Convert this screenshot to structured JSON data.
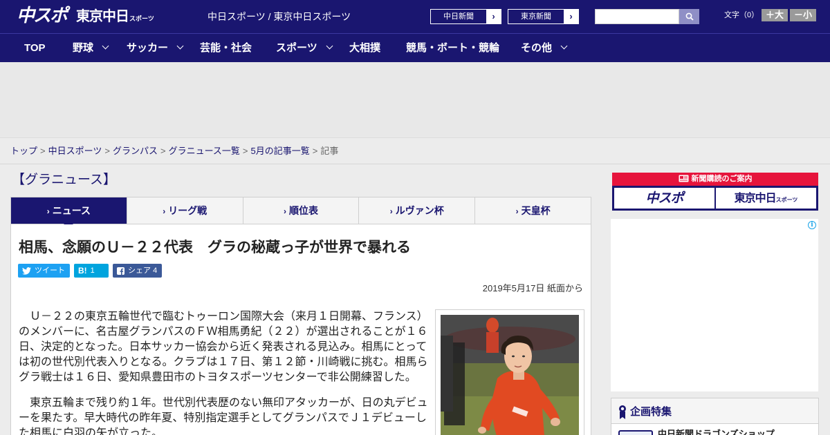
{
  "header": {
    "logo_chuspo": "中スポ",
    "logo_tokyo": "東京中日",
    "logo_tokyo_sub": "スポーツ",
    "sites_link": "中日スポーツ / 東京中日スポーツ",
    "chunichi_btn": "中日新聞",
    "tokyo_btn": "東京新聞",
    "font_label": "文字（0）",
    "font_larger": "＋大",
    "font_smaller": "－小"
  },
  "nav": {
    "items": [
      {
        "label": "TOP"
      },
      {
        "label": "野球"
      },
      {
        "label": "サッカー"
      },
      {
        "label": "芸能・社会"
      },
      {
        "label": "スポーツ"
      },
      {
        "label": "大相撲"
      },
      {
        "label": "競馬・ボート・競輪"
      },
      {
        "label": "その他"
      }
    ]
  },
  "breadcrumb": {
    "items": [
      "トップ",
      "中日スポーツ",
      "グランパス",
      "グラニュース一覧",
      "5月の記事一覧"
    ],
    "current": "記事"
  },
  "section": {
    "title": "【グラニュース】"
  },
  "tabs": [
    {
      "label": "ニュース",
      "active": true
    },
    {
      "label": "リーグ戦"
    },
    {
      "label": "順位表"
    },
    {
      "label": "ルヴァン杯"
    },
    {
      "label": "天皇杯"
    }
  ],
  "article": {
    "headline": "相馬、念願のＵ－２２代表　グラの秘蔵っ子が世界で暴れる",
    "tweet_label": "ツイート",
    "hatena_icon": "B!",
    "hatena_count": "1",
    "share_label": "シェア",
    "share_count": "4",
    "date": "2019年5月17日 紙面から",
    "paragraphs": [
      "Ｕ－２２の東京五輪世代で臨むトゥーロン国際大会（来月１日開幕、フランス）のメンバーに、名古屋グランパスのＦＷ相馬勇紀（２２）が選出されることが１６日、決定的となった。日本サッカー協会から近く発表される見込み。相馬にとっては初の世代別代表入りとなる。クラブは１７日、第１２節・川崎戦に挑む。相馬らグラ戦士は１６日、愛知県豊田市のトヨタスポーツセンターで非公開練習した。",
      "東京五輪まで残り約１年。世代別代表歴のない無印アタッカーが、日の丸デビューを果たす。早大時代の昨年夏、特別指定選手としてグランパスでＪ１デビューした相馬に白羽の矢が立った。"
    ]
  },
  "sidebar": {
    "subscribe_title": "新聞購読のご案内",
    "subscribe_chuspo": "中スポ",
    "subscribe_tokyo": "東京中日",
    "subscribe_tokyo_sub": "スポーツ",
    "feature_title": "企画特集",
    "feature_item": "中日新聞ドラゴンズショップ"
  },
  "colors": {
    "brand_navy": "#1a1670",
    "accent_red": "#e6143c",
    "twitter": "#1da1f2",
    "hatena": "#00a4de",
    "facebook": "#3b5998"
  }
}
